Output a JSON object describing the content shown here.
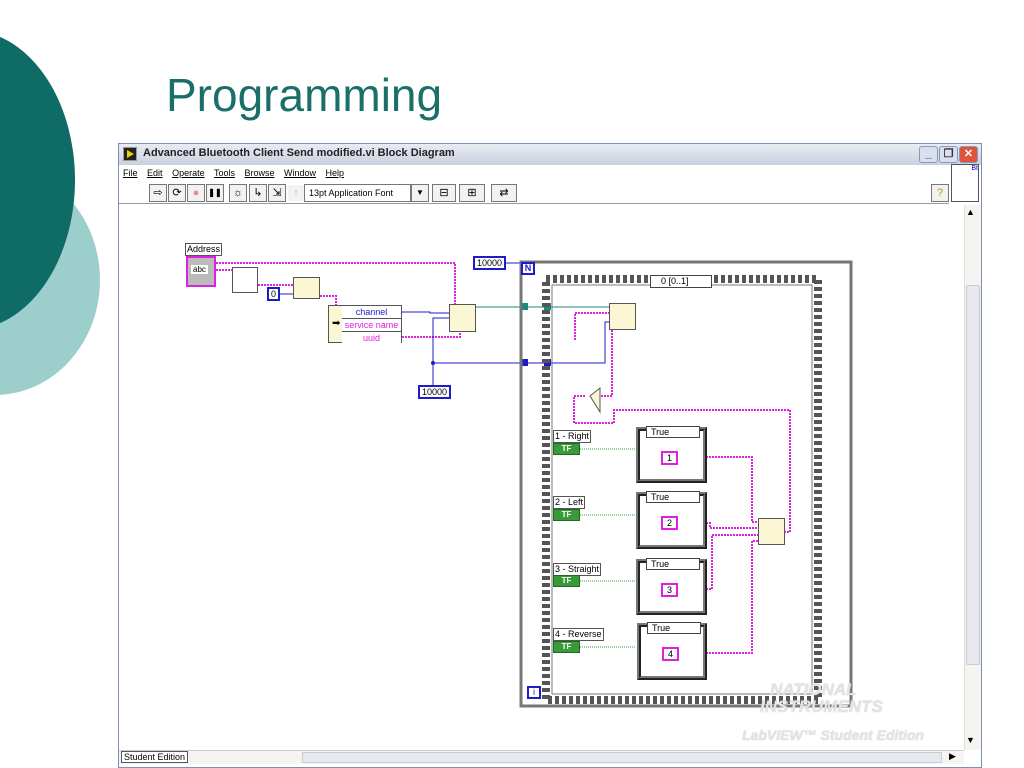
{
  "slide": {
    "title": "Programming"
  },
  "window": {
    "title": "Advanced Bluetooth Client Send modified.vi Block Diagram",
    "menu": [
      "File",
      "Edit",
      "Operate",
      "Tools",
      "Browse",
      "Window",
      "Help"
    ],
    "toolbar": {
      "font": "13pt Application Font"
    },
    "controls": {
      "minimize": "_",
      "restore": "❐",
      "close": "✕"
    },
    "status": "Student Edition"
  },
  "diagram": {
    "address_label": "Address",
    "address_control": "abc",
    "index_constant": "0",
    "cluster": [
      "channel",
      "service name",
      "uuid"
    ],
    "timeout_top": "10000",
    "timeout_bottom": "10000",
    "loop_count": "N",
    "loop_index": "i",
    "sequence_selector": "0 [0..1]",
    "buttons": [
      {
        "label": "1 - Right",
        "value": "1",
        "case": "True"
      },
      {
        "label": "2 - Left",
        "value": "2",
        "case": "True"
      },
      {
        "label": "3 - Straight",
        "value": "3",
        "case": "True"
      },
      {
        "label": "4 - Reverse",
        "value": "4",
        "case": "True"
      }
    ],
    "bool_text": "TF"
  },
  "watermark": {
    "line1": "NATIONAL",
    "line2": "INSTRUMENTS",
    "line3": "LabVIEW™ Student Edition"
  },
  "colors": {
    "slide_accent": "#1a6f69",
    "string_wire": "#e020e0",
    "numeric_wire": "#1c1cc8",
    "refnum_wire": "#1a8a7a",
    "bool_wire": "#3a9a3a"
  }
}
